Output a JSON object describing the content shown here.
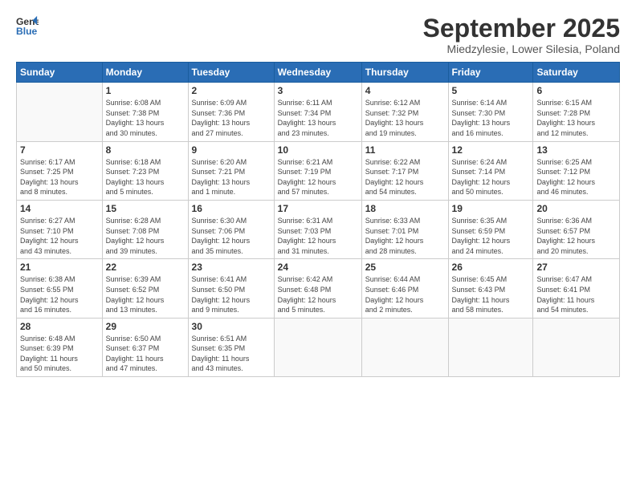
{
  "logo": {
    "line1": "General",
    "line2": "Blue"
  },
  "title": "September 2025",
  "subtitle": "Miedzylesie, Lower Silesia, Poland",
  "days_header": [
    "Sunday",
    "Monday",
    "Tuesday",
    "Wednesday",
    "Thursday",
    "Friday",
    "Saturday"
  ],
  "weeks": [
    [
      {
        "day": "",
        "info": ""
      },
      {
        "day": "1",
        "info": "Sunrise: 6:08 AM\nSunset: 7:38 PM\nDaylight: 13 hours\nand 30 minutes."
      },
      {
        "day": "2",
        "info": "Sunrise: 6:09 AM\nSunset: 7:36 PM\nDaylight: 13 hours\nand 27 minutes."
      },
      {
        "day": "3",
        "info": "Sunrise: 6:11 AM\nSunset: 7:34 PM\nDaylight: 13 hours\nand 23 minutes."
      },
      {
        "day": "4",
        "info": "Sunrise: 6:12 AM\nSunset: 7:32 PM\nDaylight: 13 hours\nand 19 minutes."
      },
      {
        "day": "5",
        "info": "Sunrise: 6:14 AM\nSunset: 7:30 PM\nDaylight: 13 hours\nand 16 minutes."
      },
      {
        "day": "6",
        "info": "Sunrise: 6:15 AM\nSunset: 7:28 PM\nDaylight: 13 hours\nand 12 minutes."
      }
    ],
    [
      {
        "day": "7",
        "info": "Sunrise: 6:17 AM\nSunset: 7:25 PM\nDaylight: 13 hours\nand 8 minutes."
      },
      {
        "day": "8",
        "info": "Sunrise: 6:18 AM\nSunset: 7:23 PM\nDaylight: 13 hours\nand 5 minutes."
      },
      {
        "day": "9",
        "info": "Sunrise: 6:20 AM\nSunset: 7:21 PM\nDaylight: 13 hours\nand 1 minute."
      },
      {
        "day": "10",
        "info": "Sunrise: 6:21 AM\nSunset: 7:19 PM\nDaylight: 12 hours\nand 57 minutes."
      },
      {
        "day": "11",
        "info": "Sunrise: 6:22 AM\nSunset: 7:17 PM\nDaylight: 12 hours\nand 54 minutes."
      },
      {
        "day": "12",
        "info": "Sunrise: 6:24 AM\nSunset: 7:14 PM\nDaylight: 12 hours\nand 50 minutes."
      },
      {
        "day": "13",
        "info": "Sunrise: 6:25 AM\nSunset: 7:12 PM\nDaylight: 12 hours\nand 46 minutes."
      }
    ],
    [
      {
        "day": "14",
        "info": "Sunrise: 6:27 AM\nSunset: 7:10 PM\nDaylight: 12 hours\nand 43 minutes."
      },
      {
        "day": "15",
        "info": "Sunrise: 6:28 AM\nSunset: 7:08 PM\nDaylight: 12 hours\nand 39 minutes."
      },
      {
        "day": "16",
        "info": "Sunrise: 6:30 AM\nSunset: 7:06 PM\nDaylight: 12 hours\nand 35 minutes."
      },
      {
        "day": "17",
        "info": "Sunrise: 6:31 AM\nSunset: 7:03 PM\nDaylight: 12 hours\nand 31 minutes."
      },
      {
        "day": "18",
        "info": "Sunrise: 6:33 AM\nSunset: 7:01 PM\nDaylight: 12 hours\nand 28 minutes."
      },
      {
        "day": "19",
        "info": "Sunrise: 6:35 AM\nSunset: 6:59 PM\nDaylight: 12 hours\nand 24 minutes."
      },
      {
        "day": "20",
        "info": "Sunrise: 6:36 AM\nSunset: 6:57 PM\nDaylight: 12 hours\nand 20 minutes."
      }
    ],
    [
      {
        "day": "21",
        "info": "Sunrise: 6:38 AM\nSunset: 6:55 PM\nDaylight: 12 hours\nand 16 minutes."
      },
      {
        "day": "22",
        "info": "Sunrise: 6:39 AM\nSunset: 6:52 PM\nDaylight: 12 hours\nand 13 minutes."
      },
      {
        "day": "23",
        "info": "Sunrise: 6:41 AM\nSunset: 6:50 PM\nDaylight: 12 hours\nand 9 minutes."
      },
      {
        "day": "24",
        "info": "Sunrise: 6:42 AM\nSunset: 6:48 PM\nDaylight: 12 hours\nand 5 minutes."
      },
      {
        "day": "25",
        "info": "Sunrise: 6:44 AM\nSunset: 6:46 PM\nDaylight: 12 hours\nand 2 minutes."
      },
      {
        "day": "26",
        "info": "Sunrise: 6:45 AM\nSunset: 6:43 PM\nDaylight: 11 hours\nand 58 minutes."
      },
      {
        "day": "27",
        "info": "Sunrise: 6:47 AM\nSunset: 6:41 PM\nDaylight: 11 hours\nand 54 minutes."
      }
    ],
    [
      {
        "day": "28",
        "info": "Sunrise: 6:48 AM\nSunset: 6:39 PM\nDaylight: 11 hours\nand 50 minutes."
      },
      {
        "day": "29",
        "info": "Sunrise: 6:50 AM\nSunset: 6:37 PM\nDaylight: 11 hours\nand 47 minutes."
      },
      {
        "day": "30",
        "info": "Sunrise: 6:51 AM\nSunset: 6:35 PM\nDaylight: 11 hours\nand 43 minutes."
      },
      {
        "day": "",
        "info": ""
      },
      {
        "day": "",
        "info": ""
      },
      {
        "day": "",
        "info": ""
      },
      {
        "day": "",
        "info": ""
      }
    ]
  ]
}
